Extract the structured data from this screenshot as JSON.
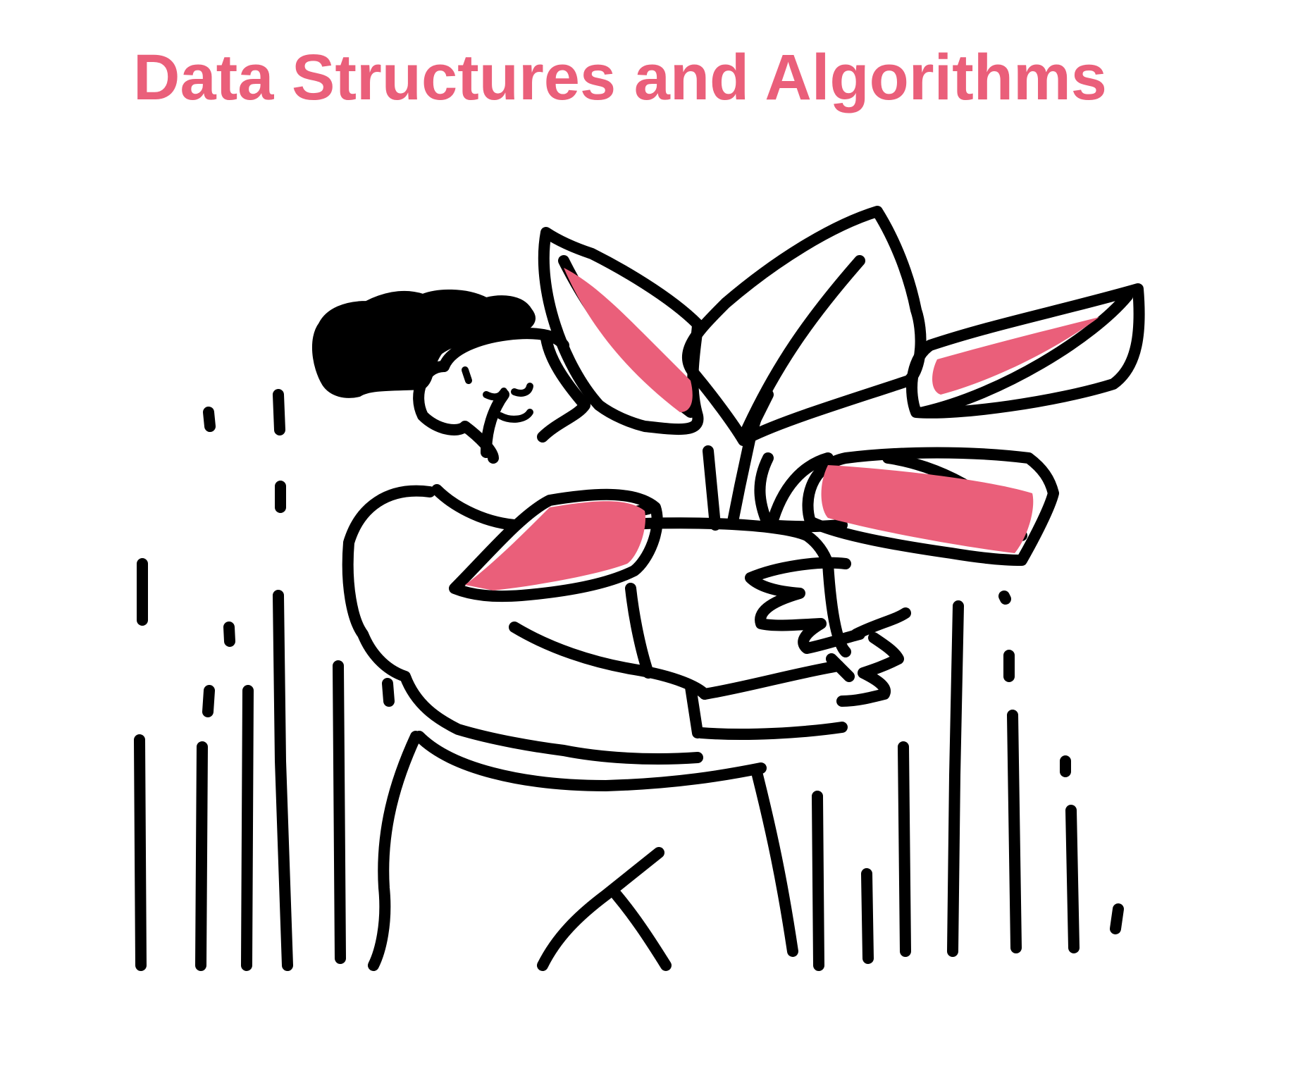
{
  "title": "Data Structures and Algorithms",
  "colors": {
    "accent": "#ea5f7a",
    "ink": "#000000",
    "background": "#ffffff"
  },
  "illustration": {
    "subject": "woman-holding-potted-plant"
  }
}
